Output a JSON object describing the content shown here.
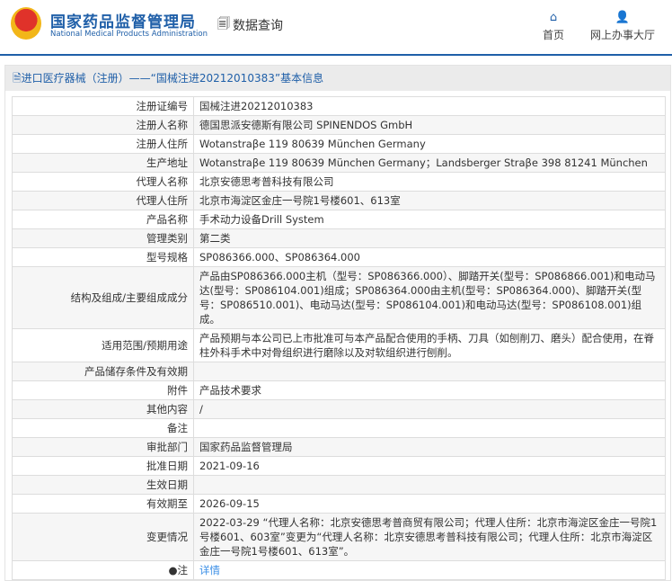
{
  "header": {
    "logo_cn": "国家药品监督管理局",
    "logo_en": "National Medical Products Administration",
    "query": "数据查询",
    "nav": [
      {
        "icon": "home-icon",
        "label": "首页"
      },
      {
        "icon": "user-icon",
        "label": "网上办事大厅"
      }
    ]
  },
  "panel_title": "进口医疗器械（注册）——“国械注进20212010383”基本信息",
  "rows": [
    {
      "label": "注册证编号",
      "value": "国械注进20212010383"
    },
    {
      "label": "注册人名称",
      "value": "德国思派安德斯有限公司 SPINENDOS GmbH"
    },
    {
      "label": "注册人住所",
      "value": "Wotanstraβe 119 80639 München Germany"
    },
    {
      "label": "生产地址",
      "value": "Wotanstraβe 119 80639 München Germany；Landsberger Straβe 398 81241 München"
    },
    {
      "label": "代理人名称",
      "value": "北京安德思考普科技有限公司"
    },
    {
      "label": "代理人住所",
      "value": "北京市海淀区金庄一号院1号楼601、613室"
    },
    {
      "label": "产品名称",
      "value": "手术动力设备Drill System"
    },
    {
      "label": "管理类别",
      "value": "第二类"
    },
    {
      "label": "型号规格",
      "value": "SP086366.000、SP086364.000"
    },
    {
      "label": "结构及组成/主要组成成分",
      "value": "产品由SP086366.000主机（型号：SP086366.000）、脚踏开关(型号：SP086866.001)和电动马达(型号：SP086104.001)组成；SP086364.000由主机(型号：SP086364.000)、脚踏开关(型号：SP086510.001)、电动马达(型号：SP086104.001)和电动马达(型号：SP086108.001)组成。"
    },
    {
      "label": "适用范围/预期用途",
      "value": "产品预期与本公司已上市批准可与本产品配合使用的手柄、刀具（如刨削刀、磨头）配合使用，在脊柱外科手术中对骨组织进行磨除以及对软组织进行刨削。"
    },
    {
      "label": "产品储存条件及有效期",
      "value": ""
    },
    {
      "label": "附件",
      "value": "产品技术要求"
    },
    {
      "label": "其他内容",
      "value": "/"
    },
    {
      "label": "备注",
      "value": ""
    },
    {
      "label": "审批部门",
      "value": "国家药品监督管理局"
    },
    {
      "label": "批准日期",
      "value": "2021-09-16"
    },
    {
      "label": "生效日期",
      "value": ""
    },
    {
      "label": "有效期至",
      "value": "2026-09-15"
    },
    {
      "label": "变更情况",
      "value": "2022-03-29 “代理人名称：北京安德思考普商贸有限公司；代理人住所：北京市海淀区金庄一号院1号楼601、603室”变更为“代理人名称：北京安德思考普科技有限公司；代理人住所：北京市海淀区金庄一号院1号楼601、613室”。"
    }
  ],
  "note": {
    "label": "注",
    "link": "详情"
  }
}
